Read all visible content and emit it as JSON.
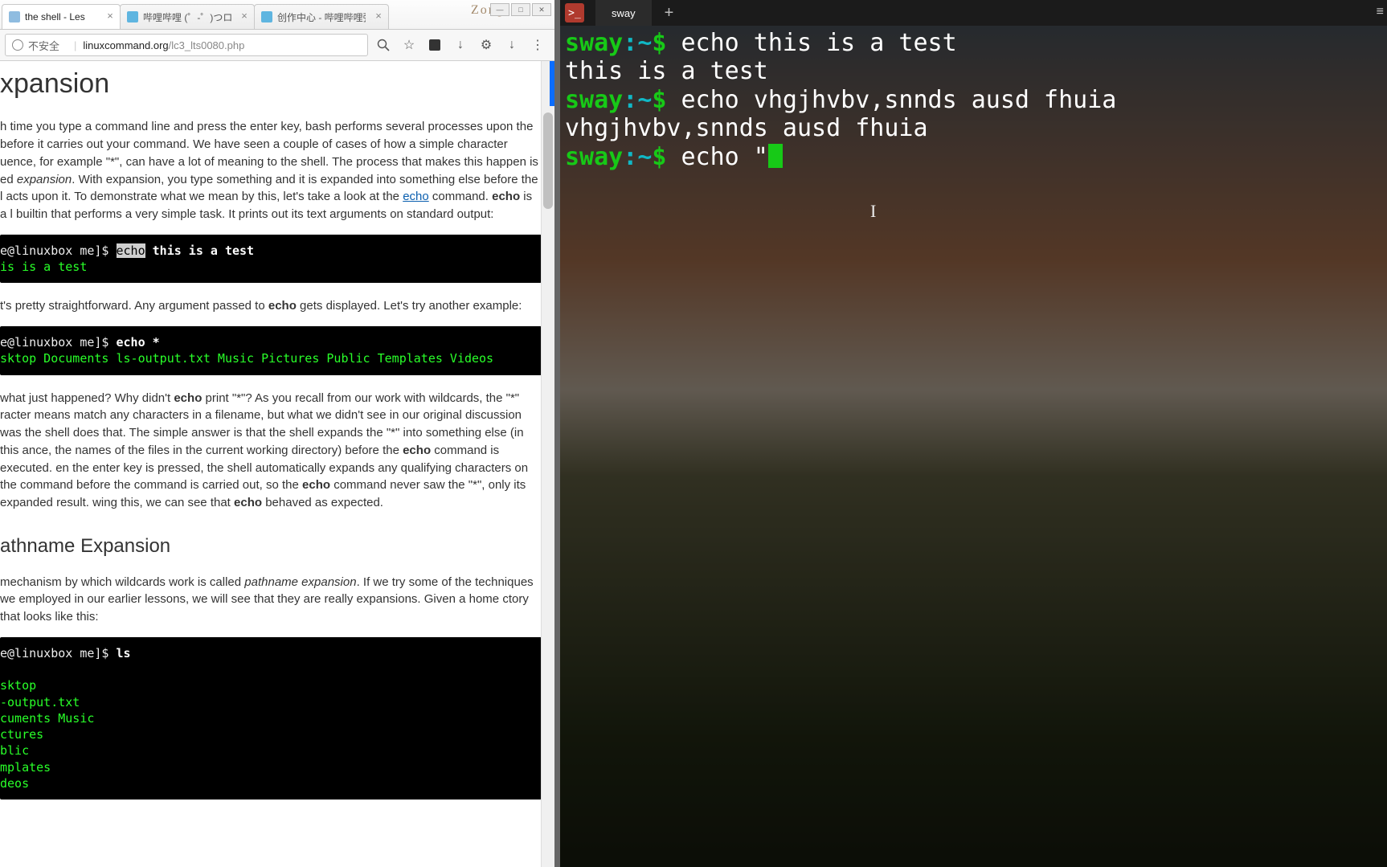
{
  "browser": {
    "tabs": [
      {
        "label": "the shell - Les",
        "active": true
      },
      {
        "label": "哔哩哔哩 (゜-゜)つロ 干",
        "active": false
      },
      {
        "label": "创作中心 - 哔哩哔哩弹幕",
        "active": false
      }
    ],
    "window_badge": "Zong",
    "address": {
      "insecure_label": "不安全",
      "host": "linuxcommand.org",
      "path": "/lc3_lts0080.php"
    }
  },
  "article": {
    "heading": "xpansion",
    "p1_a": "h time you type a command line and press the enter key, bash performs several processes upon the before it carries out your command. We have seen a couple of cases of how a simple character uence, for example \"*\", can have a lot of meaning to the shell. The process that makes this happen is ed ",
    "p1_b": "expansion",
    "p1_c": ". With expansion, you type something and it is expanded into something else before the l acts upon it. To demonstrate what we mean by this, let's take a look at the ",
    "echo_link": "echo",
    "p1_d": " command. ",
    "p1_e": "echo",
    "p1_f": " is a l builtin that performs a very simple task. It prints out its text arguments on standard output:",
    "code1_prompt": "e@linuxbox me]$",
    "code1_cmd_hi": "echo",
    "code1_cmd_rest": " this is a test",
    "code1_out": "is is a test",
    "p2_a": "t's pretty straightforward. Any argument passed to ",
    "p2_b": "echo",
    "p2_c": " gets displayed. Let's try another example:",
    "code2_prompt": "e@linuxbox me]$",
    "code2_cmd": "echo *",
    "code2_out": "sktop Documents ls-output.txt Music Pictures Public Templates Videos",
    "p3_a": "what just happened? Why didn't ",
    "p3_b": "echo",
    "p3_c": " print \"*\"? As you recall from our work with wildcards, the \"*\" racter means match any characters in a filename, but what we didn't see in our original discussion was the shell does that. The simple answer is that the shell expands the \"*\" into something else (in this ance, the names of the files in the current working directory) before the ",
    "p3_d": "echo",
    "p3_e": " command is executed. en the enter key is pressed, the shell automatically expands any qualifying characters on the command before the command is carried out, so the ",
    "p3_f": "echo",
    "p3_g": " command never saw the \"*\", only its expanded result. wing this, we can see that ",
    "p3_h": "echo",
    "p3_i": " behaved as expected.",
    "h2": "athname Expansion",
    "p4_a": "mechanism by which wildcards work is called ",
    "p4_b": "pathname expansion",
    "p4_c": ". If we try some of the techniques we employed in our earlier lessons, we will see that they are really expansions. Given a home ctory that looks like this:",
    "code3_prompt": "e@linuxbox me]$",
    "code3_cmd": "ls",
    "code3_out": "sktop\n-output.txt\ncuments Music\nctures\nblic\nmplates\ndeos"
  },
  "terminal": {
    "tab_label": "sway",
    "lines": [
      {
        "host": "sway",
        "sep": ":",
        "path": "~",
        "prompt": "$ ",
        "cmd": "echo this is a test"
      },
      {
        "out": "this is a test"
      },
      {
        "host": "sway",
        "sep": ":",
        "path": "~",
        "prompt": "$ ",
        "cmd": "echo vhgjhvbv,snnds ausd fhuia"
      },
      {
        "out": "vhgjhvbv,snnds ausd fhuia"
      },
      {
        "host": "sway",
        "sep": ":",
        "path": "~",
        "prompt": "$ ",
        "cmd": "echo \"",
        "cursor": true
      }
    ]
  }
}
